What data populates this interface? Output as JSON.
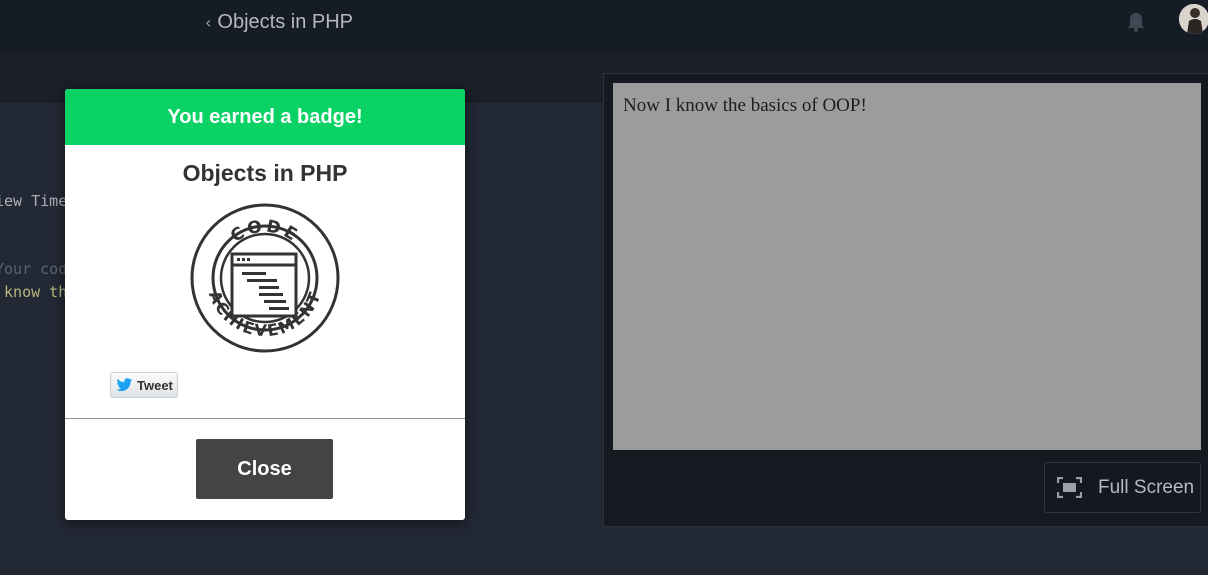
{
  "header": {
    "back_label": "Objects in PHP",
    "back_chevron": "‹"
  },
  "editor": {
    "line_1": "iew Time",
    "line_2": "Your cod",
    "line_3": " know th"
  },
  "preview": {
    "output_text": "Now I know the basics of OOP!",
    "fullscreen_label": "Full Screen"
  },
  "modal": {
    "header": "You earned a badge!",
    "badge_title": "Objects in PHP",
    "badge_ring_top": "CODE",
    "badge_ring_bottom": "ACHIEVEMENT",
    "tweet_label": "Tweet",
    "close_label": "Close"
  },
  "colors": {
    "accent_green": "#0bd265",
    "topbar": "#151c25",
    "editor_bg": "#222834",
    "close_button": "#444444"
  },
  "icons": [
    "bell-icon",
    "avatar",
    "fullscreen-icon",
    "twitter-bird-icon",
    "code-achievement-badge"
  ]
}
